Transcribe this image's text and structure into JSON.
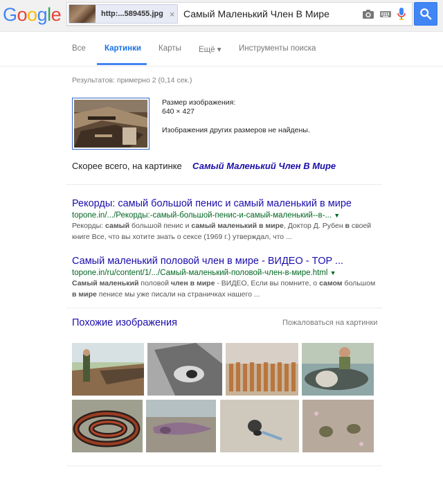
{
  "logo": {
    "letters": [
      "G",
      "o",
      "o",
      "g",
      "l",
      "e"
    ],
    "colors": [
      "#4285f4",
      "#ea4335",
      "#fbbc05",
      "#4285f4",
      "#34a853",
      "#ea4335"
    ]
  },
  "search": {
    "image_chip_text": "http:...589455.jpg",
    "chip_close": "×",
    "query": "Самый Маленький Член В Мире"
  },
  "tabs": [
    {
      "label": "Все"
    },
    {
      "label": "Картинки",
      "active": true
    },
    {
      "label": "Карты"
    },
    {
      "label": "Ещё ▾"
    },
    {
      "label": "Инструменты поиска"
    }
  ],
  "results_count": "Результатов: примерно 2 (0,14 сек.)",
  "image_info": {
    "size_label": "Размер изображения:",
    "size_value": "640 × 427",
    "no_other_sizes": "Изображения других размеров не найдены."
  },
  "best_guess": {
    "label": "Скорее всего, на картинке",
    "link": "Самый Маленький Член В Мире"
  },
  "results": [
    {
      "title": "Рекорды: самый большой пенис и самый маленький в мире",
      "url": "topone.in/.../Рекорды:-самый-большой-пенис-и-самый-маленький--в-...",
      "snippet_html": "Рекорды: <b>самый</b> большой пенис и <b>самый маленький в мире</b>, Доктор Д. Рубен <b>в</b> своей книге Все, что вы хотите знать о сексе (1969 г.) утверждал, что ..."
    },
    {
      "title": "Самый маленький половой член в мире - ВИДЕО - TOP ...",
      "url": "topone.in/ru/content/1/.../Самый-маленький-половой-член-в-мире.html",
      "snippet_html": "<b>Самый маленький</b> половой <b>член в мире</b> - ВИДЕО, Если вы помните, о <b>самом</b> большом <b>в мире</b> пенисе мы уже писали на страничках нашего ..."
    }
  ],
  "similar": {
    "title": "Похожие изображения",
    "report": "Пожаловаться на картинки"
  },
  "colors": {
    "link": "#1a0dab",
    "url": "#006621",
    "accent": "#4285f4"
  }
}
